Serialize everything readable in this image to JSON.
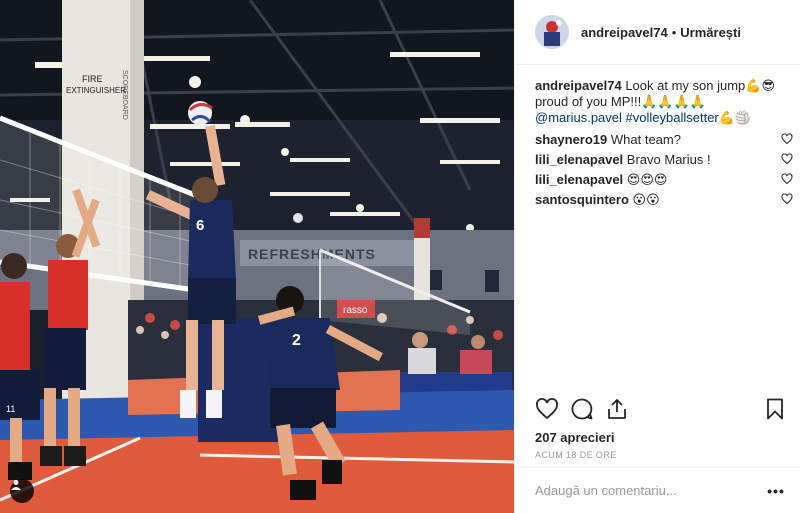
{
  "post": {
    "author": "andreipavel74",
    "separator": "•",
    "follow_label": "Urmărești",
    "caption": {
      "username": "andreipavel74",
      "text": " Look at my son jump",
      "emoji_1": "💪😎",
      "text_2": " proud of you MP!!!",
      "emoji_2": "🙏🙏🙏🙏",
      "mention": "@marius.pavel",
      "hashtag": "#volleyballsetter",
      "emoji_3": "💪🏐"
    },
    "comments": [
      {
        "username": "shaynero19",
        "text": "What team?"
      },
      {
        "username": "lili_elenapavel",
        "text": "Bravo Marius !"
      },
      {
        "username": "lili_elenapavel",
        "text": "😍😍😍"
      },
      {
        "username": "santosquintero",
        "text": "😮😮"
      }
    ],
    "likes": "207 aprecieri",
    "timestamp": "ACUM 18 DE ORE",
    "add_comment_placeholder": "Adaugă un comentariu...",
    "more_label": "•••"
  },
  "photo": {
    "wall_sign_left_1": "FIRE",
    "wall_sign_left_2": "EXTINGUISHER",
    "wall_sign_pillar": "SCOREBOARD",
    "banner": "REFRESHMENTS",
    "ad_board": "rasso",
    "player_number_jumper": "6",
    "player_number_front": "2",
    "player_number_left": "11"
  },
  "colors": {
    "text": "#262626",
    "muted": "#999999",
    "link": "#003569",
    "border": "#efefef",
    "court_orange": "#e2573a",
    "court_blue": "#3e67b5"
  },
  "icons": [
    "heart-icon",
    "comment-icon",
    "share-icon",
    "bookmark-icon",
    "tag-user-icon"
  ]
}
